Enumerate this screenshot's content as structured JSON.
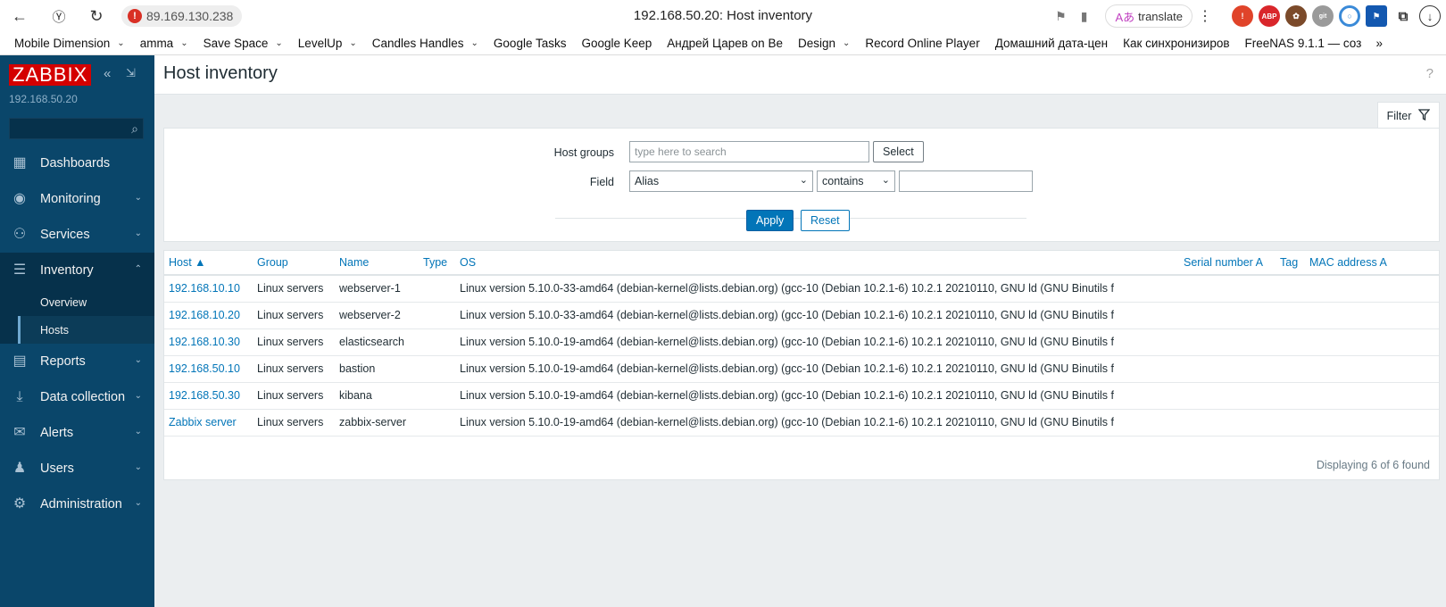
{
  "browser": {
    "address": "89.169.130.238",
    "page_title": "192.168.50.20: Host inventory",
    "translate_label": "translate",
    "bookmarks": [
      {
        "label": "Mobile Dimension",
        "dropdown": true
      },
      {
        "label": "amma",
        "dropdown": true
      },
      {
        "label": "Save Space",
        "dropdown": true
      },
      {
        "label": "LevelUp",
        "dropdown": true
      },
      {
        "label": "Candles Handles",
        "dropdown": true
      },
      {
        "label": "Google Tasks",
        "dropdown": false
      },
      {
        "label": "Google Keep",
        "dropdown": false
      },
      {
        "label": "Андрей Царев on Be",
        "dropdown": false
      },
      {
        "label": "Design",
        "dropdown": true
      },
      {
        "label": "Record Online Player",
        "dropdown": false
      },
      {
        "label": "Домашний дата-цен",
        "dropdown": false
      },
      {
        "label": "Как синхронизиров",
        "dropdown": false
      },
      {
        "label": "FreeNAS 9.1.1 — соз",
        "dropdown": false
      }
    ],
    "bookmarks_more": "»"
  },
  "sidebar": {
    "logo": "ZABBIX",
    "server_name": "192.168.50.20",
    "menu": [
      {
        "label": "Dashboards",
        "icon": "dashboard-icon",
        "glyph": "▦",
        "chevron": false
      },
      {
        "label": "Monitoring",
        "icon": "eye-icon",
        "glyph": "◉",
        "chevron": true
      },
      {
        "label": "Services",
        "icon": "services-icon",
        "glyph": "⚇",
        "chevron": true
      },
      {
        "label": "Inventory",
        "icon": "list-icon",
        "glyph": "☰",
        "chevron": true
      },
      {
        "label": "Reports",
        "icon": "report-icon",
        "glyph": "▤",
        "chevron": true
      },
      {
        "label": "Data collection",
        "icon": "download-icon",
        "glyph": "⤓",
        "chevron": true
      },
      {
        "label": "Alerts",
        "icon": "envelope-icon",
        "glyph": "✉",
        "chevron": true
      },
      {
        "label": "Users",
        "icon": "users-icon",
        "glyph": "♟",
        "chevron": true
      },
      {
        "label": "Administration",
        "icon": "gear-icon",
        "glyph": "⚙",
        "chevron": true
      }
    ],
    "inventory_sub": [
      "Overview",
      "Hosts"
    ]
  },
  "main": {
    "title": "Host inventory",
    "filter_tab_label": "Filter",
    "filter": {
      "host_groups_label": "Host groups",
      "host_groups_placeholder": "type here to search",
      "select_label": "Select",
      "field_label": "Field",
      "field_value": "Alias",
      "operator_value": "contains",
      "field_text_value": "",
      "apply_label": "Apply",
      "reset_label": "Reset"
    },
    "table": {
      "columns": [
        "Host ▲",
        "Group",
        "Name",
        "Type",
        "OS",
        "Serial number A",
        "Tag",
        "MAC address A"
      ],
      "rows": [
        {
          "host": "192.168.10.10",
          "group": "Linux servers",
          "name": "webserver-1",
          "type": "",
          "os": "Linux version 5.10.0-33-amd64 (debian-kernel@lists.debian.org) (gcc-10 (Debian 10.2.1-6) 10.2.1 20210110, GNU ld (GNU Binutils f"
        },
        {
          "host": "192.168.10.20",
          "group": "Linux servers",
          "name": "webserver-2",
          "type": "",
          "os": "Linux version 5.10.0-33-amd64 (debian-kernel@lists.debian.org) (gcc-10 (Debian 10.2.1-6) 10.2.1 20210110, GNU ld (GNU Binutils f"
        },
        {
          "host": "192.168.10.30",
          "group": "Linux servers",
          "name": "elasticsearch",
          "type": "",
          "os": "Linux version 5.10.0-19-amd64 (debian-kernel@lists.debian.org) (gcc-10 (Debian 10.2.1-6) 10.2.1 20210110, GNU ld (GNU Binutils f"
        },
        {
          "host": "192.168.50.10",
          "group": "Linux servers",
          "name": "bastion",
          "type": "",
          "os": "Linux version 5.10.0-19-amd64 (debian-kernel@lists.debian.org) (gcc-10 (Debian 10.2.1-6) 10.2.1 20210110, GNU ld (GNU Binutils f"
        },
        {
          "host": "192.168.50.30",
          "group": "Linux servers",
          "name": "kibana",
          "type": "",
          "os": "Linux version 5.10.0-19-amd64 (debian-kernel@lists.debian.org) (gcc-10 (Debian 10.2.1-6) 10.2.1 20210110, GNU ld (GNU Binutils f"
        },
        {
          "host": "Zabbix server",
          "group": "Linux servers",
          "name": "zabbix-server",
          "type": "",
          "os": "Linux version 5.10.0-19-amd64 (debian-kernel@lists.debian.org) (gcc-10 (Debian 10.2.1-6) 10.2.1 20210110, GNU ld (GNU Binutils f"
        }
      ],
      "footer": "Displaying 6 of 6 found"
    }
  }
}
